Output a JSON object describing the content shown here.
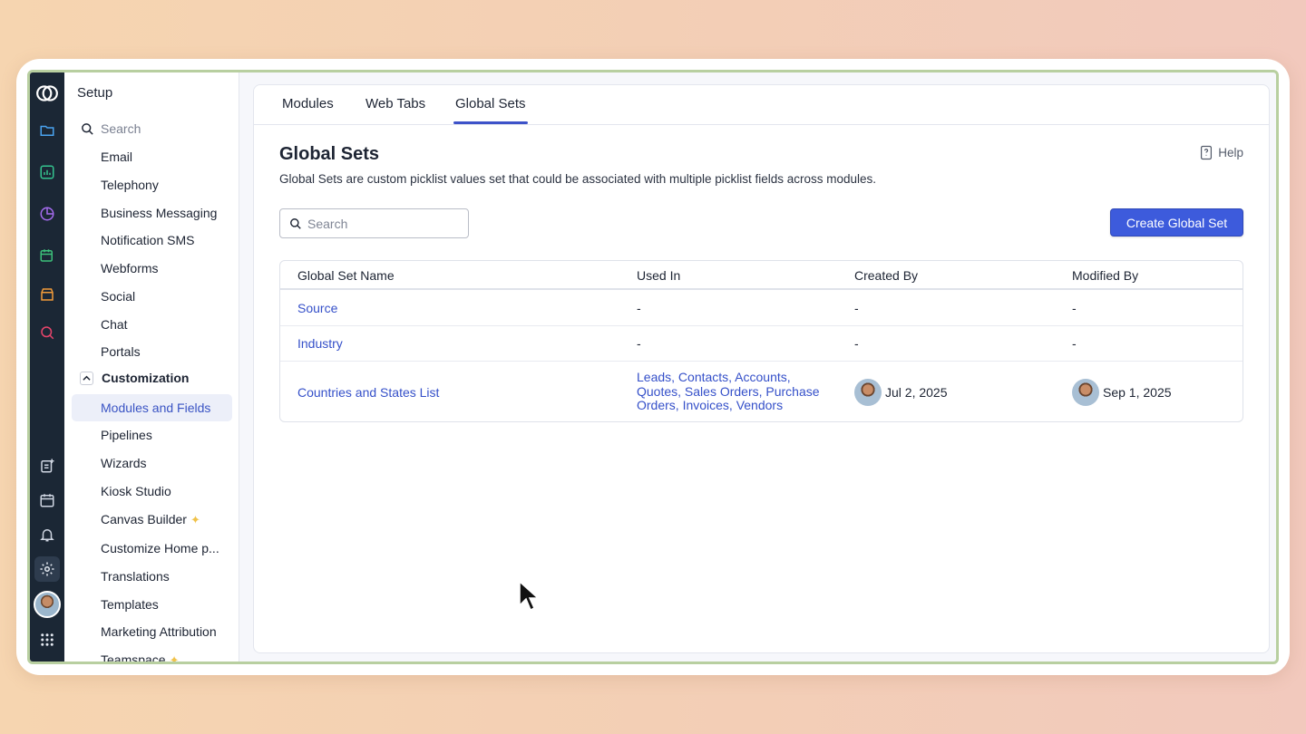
{
  "sidebar": {
    "title": "Setup",
    "search_placeholder": "Search",
    "items_top": [
      "Email",
      "Telephony",
      "Business Messaging",
      "Notification SMS",
      "Webforms",
      "Social",
      "Chat",
      "Portals"
    ],
    "group_label": "Customization",
    "items_group": [
      "Modules and Fields",
      "Pipelines",
      "Wizards",
      "Kiosk Studio",
      "Canvas Builder",
      "Customize Home p...",
      "Translations",
      "Templates",
      "Marketing Attribution",
      "Teamspace"
    ]
  },
  "tabs": [
    "Modules",
    "Web Tabs",
    "Global Sets"
  ],
  "page": {
    "title": "Global Sets",
    "description": "Global Sets are custom picklist values set that could be associated with multiple picklist fields across modules.",
    "help_label": "Help",
    "search_placeholder": "Search",
    "create_button": "Create Global Set"
  },
  "table": {
    "headers": [
      "Global Set Name",
      "Used In",
      "Created By",
      "Modified By"
    ],
    "rows": [
      {
        "name": "Source",
        "used_in": "-",
        "created": "-",
        "modified": "-"
      },
      {
        "name": "Industry",
        "used_in": "-",
        "created": "-",
        "modified": "-"
      },
      {
        "name": "Countries and States List",
        "used_in": [
          "Leads, Contacts, Accounts,",
          "Quotes, Sales Orders, Purchase",
          "Orders, Invoices, Vendors"
        ],
        "created": "Jul 2, 2025",
        "modified": "Sep 1, 2025"
      }
    ]
  },
  "colors": {
    "accent": "#3d5bdc",
    "link": "#3550c9",
    "rail": "#1b2735"
  }
}
